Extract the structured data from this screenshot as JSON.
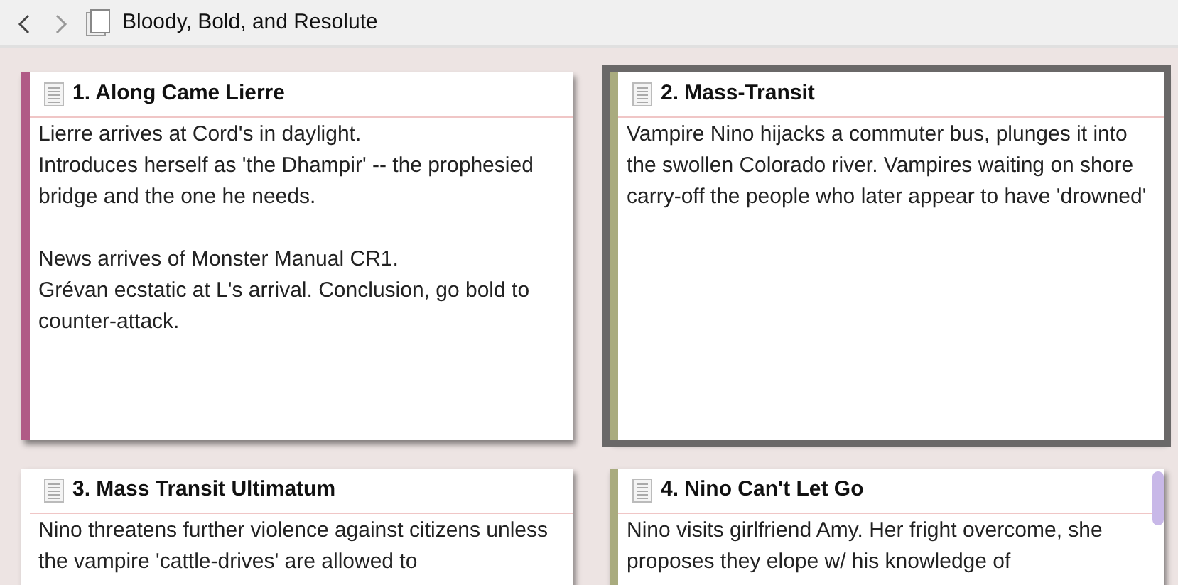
{
  "toolbar": {
    "title": "Bloody, Bold, and Resolute"
  },
  "cards": [
    {
      "title": "1. Along Came Lierre",
      "color": "#b05a86",
      "selected": false,
      "text": "Lierre arrives at Cord's in daylight.\nIntroduces herself as 'the Dhampir' -- the prophesied bridge and the one he needs.\n\nNews arrives of Monster Manual CR1.\nGrévan ecstatic at L's arrival.  Conclusion, go bold to counter-attack."
    },
    {
      "title": "2. Mass-Transit",
      "color": "#a9ab7e",
      "selected": true,
      "text": "Vampire Nino hijacks a commuter bus, plunges it into the swollen Colorado river.  Vampires waiting on shore carry-off the people who later appear to have 'drowned'"
    },
    {
      "title": "3. Mass Transit Ultimatum",
      "selected": false,
      "text": "Nino threatens further violence against citizens unless the vampire 'cattle-drives' are allowed to"
    },
    {
      "title": "4. Nino Can't Let Go",
      "color": "#a9ab7e",
      "selected": false,
      "text": "Nino visits girlfriend Amy.  Her fright overcome, she proposes they elope w/ his knowledge of"
    }
  ]
}
